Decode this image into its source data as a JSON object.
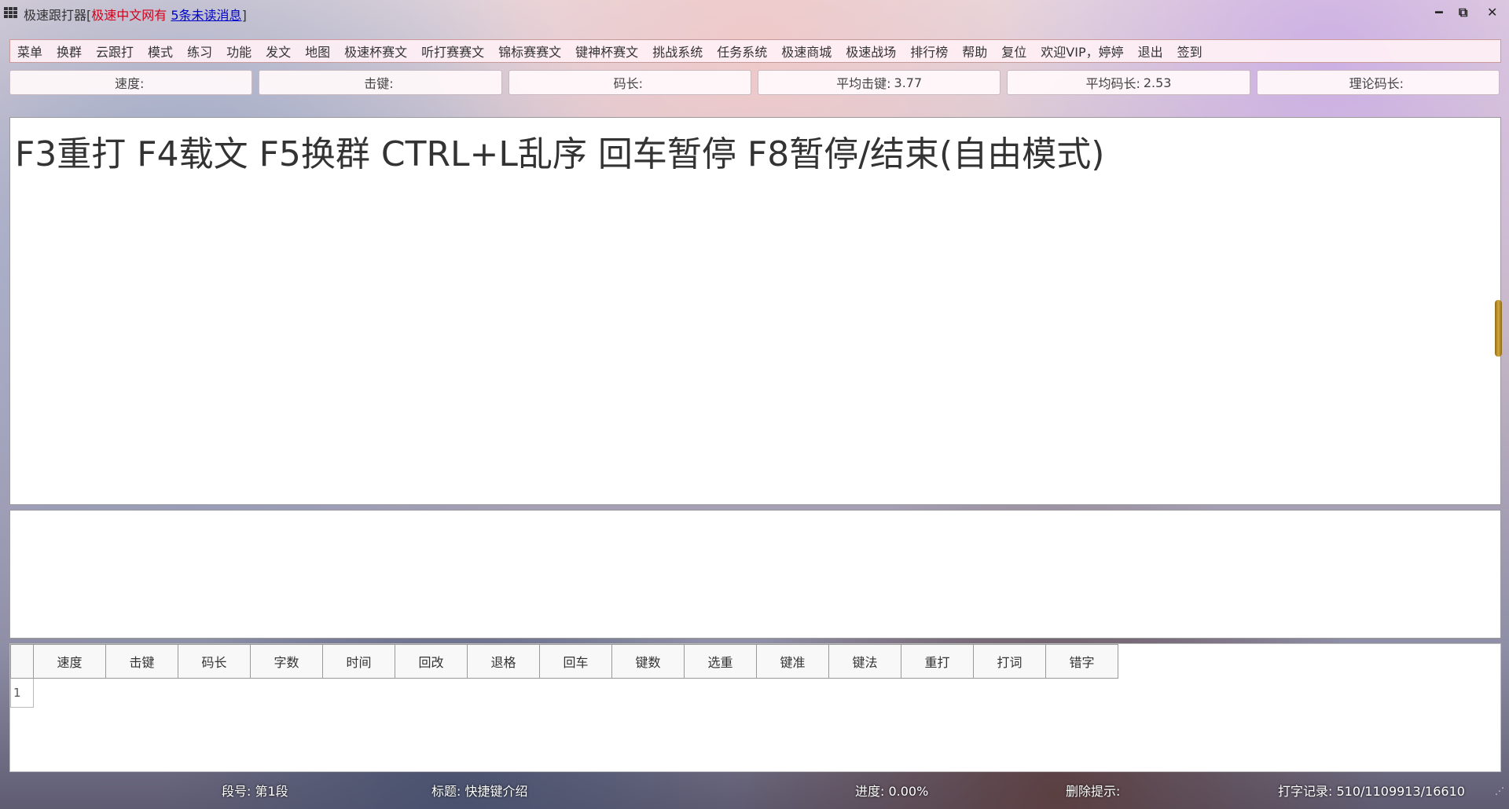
{
  "window": {
    "app_name": "极速跟打器",
    "bracket_open": "[",
    "site_name": "极速中文网有",
    "unread": "5条未读消息",
    "bracket_close": "]",
    "minimize": "━",
    "restore": "⧉",
    "close": "✕"
  },
  "menu": [
    "菜单",
    "换群",
    "云跟打",
    "模式",
    "练习",
    "功能",
    "发文",
    "地图",
    "极速杯赛文",
    "听打赛赛文",
    "锦标赛赛文",
    "键神杯赛文",
    "挑战系统",
    "任务系统",
    "极速商城",
    "极速战场",
    "排行榜",
    "帮助",
    "复位",
    "欢迎VIP，婷婷",
    "退出",
    "签到"
  ],
  "stats": {
    "speed_label": "速度:",
    "speed_value": "",
    "keystroke_label": "击键:",
    "keystroke_value": "",
    "codelen_label": "码长:",
    "codelen_value": "",
    "avg_keystroke_label": "平均击键:",
    "avg_keystroke_value": "3.77",
    "avg_codelen_label": "平均码长:",
    "avg_codelen_value": "2.53",
    "theory_codelen_label": "理论码长:",
    "theory_codelen_value": ""
  },
  "text_display": "F3重打 F4载文 F5换群 CTRL+L乱序 回车暂停 F8暂停/结束(自由模式)",
  "input": {
    "value": ""
  },
  "results": {
    "columns": [
      "速度",
      "击键",
      "码长",
      "字数",
      "时间",
      "回改",
      "退格",
      "回车",
      "键数",
      "选重",
      "键准",
      "键法",
      "重打",
      "打词",
      "错字"
    ],
    "rows": [
      {
        "index": "1"
      }
    ]
  },
  "status": {
    "segment": "段号: 第1段",
    "title": "标题: 快捷键介绍",
    "progress": "进度: 0.00%",
    "hint": "删除提示:",
    "record": "打字记录: 510/1109913/16610"
  },
  "icons": [
    "app-grid-icon",
    "minimize-icon",
    "restore-icon",
    "close-icon",
    "resize-grip-icon"
  ]
}
